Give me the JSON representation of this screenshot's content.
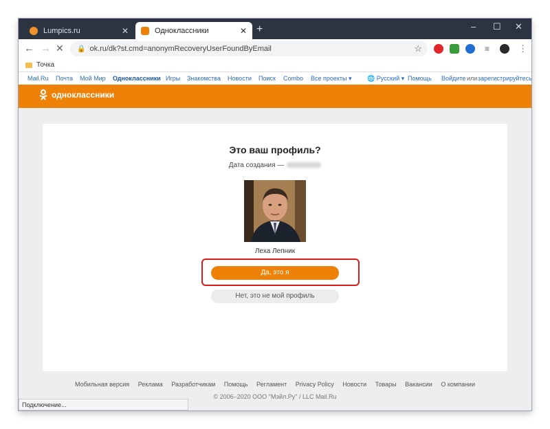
{
  "browser": {
    "tabs": [
      {
        "label": "Lumpics.ru",
        "favicon_color": "#f0922e"
      },
      {
        "label": "Одноклассники",
        "favicon_color": "#ee8208"
      }
    ],
    "new_tab": "+",
    "window_controls": {
      "minimize": "–",
      "maximize": "☐",
      "close": "✕"
    },
    "tab_close": "✕",
    "url": "ok.ru/dk?st.cmd=anonymRecoveryUserFoundByEmail",
    "bookmarks": [
      "Точка"
    ],
    "status_text": "Подключение..."
  },
  "portal_bar": {
    "links": [
      "Mail.Ru",
      "Почта",
      "Мой Мир",
      "Одноклассники",
      "Игры",
      "Знакомства",
      "Новости",
      "Поиск",
      "Combo",
      "Все проекты ▾"
    ],
    "language": "Русский ▾",
    "help": "Помощь",
    "login": "Войдите",
    "or": "или",
    "register": "зарегистрируйтесь"
  },
  "site": {
    "logo_text": "одноклассники",
    "brand_color": "#ee8208"
  },
  "card": {
    "title": "Это ваш профиль?",
    "created_label": "Дата создания —",
    "user_name": "Леха Лепник",
    "yes_button": "Да, это я",
    "no_button": "Нет, это не мой профиль"
  },
  "footer": {
    "links": [
      "Мобильная версия",
      "Реклама",
      "Разработчикам",
      "Помощь",
      "Регламент",
      "Privacy Policy",
      "Новости",
      "Товары",
      "Вакансии",
      "О компании"
    ],
    "copyright": "© 2006–2020 ООО \"Мэйл.Ру\" / LLC Mail.Ru"
  }
}
